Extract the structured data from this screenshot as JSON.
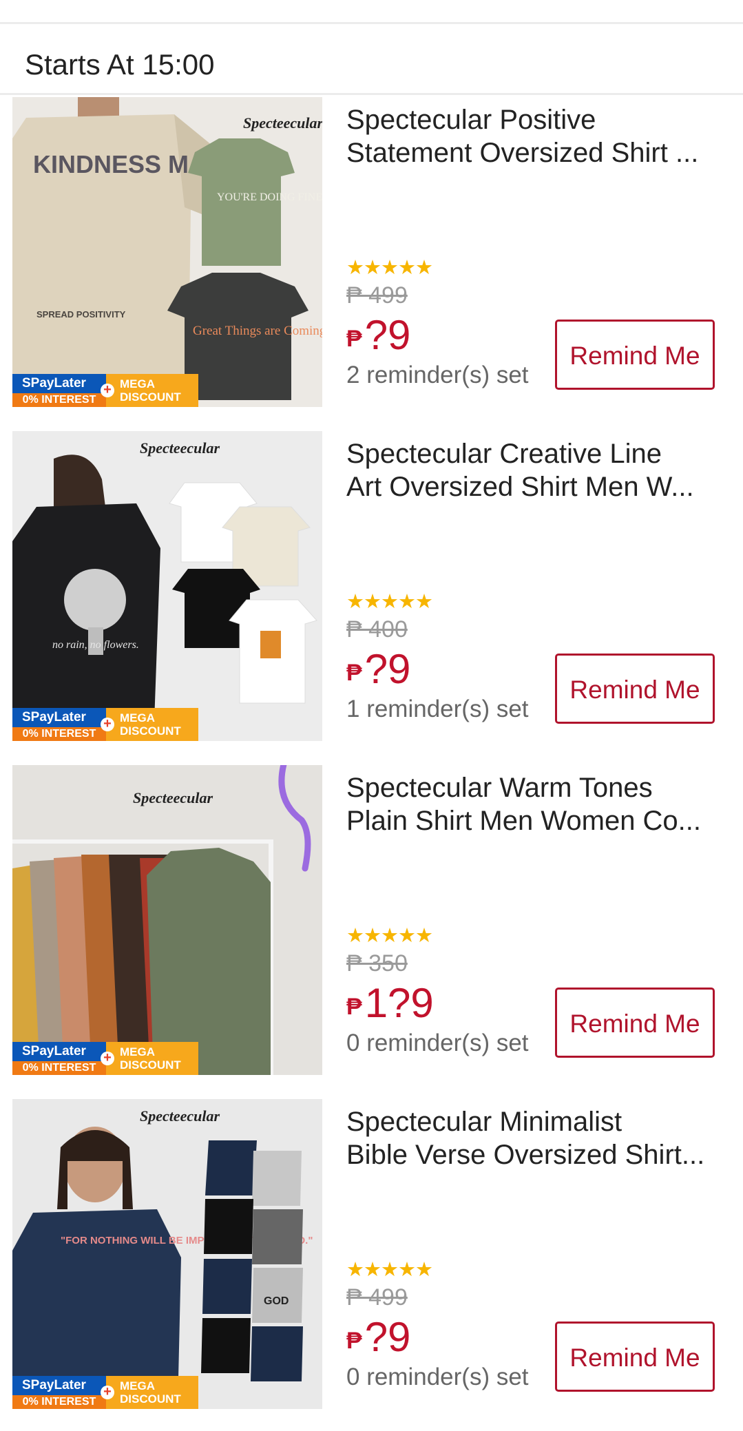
{
  "header": {
    "label": "Starts At 15:00"
  },
  "badges": {
    "spaylater": "SPayLater",
    "interest": "0% INTEREST",
    "mega_1": "MEGA",
    "mega_2": "DISCOUNT"
  },
  "colors": {
    "accent": "#c1122c",
    "star": "#f7b500",
    "strike": "#9a9a9a"
  },
  "products": [
    {
      "title_line1": "Spectecular Positive",
      "title_line2": "Statement Oversized Shirt ...",
      "rating_stars": "★★★★★",
      "original_price": "₱ 499",
      "currency": "₱",
      "flash_price": "?9",
      "reminders": "2 reminder(s) set",
      "button": "Remind Me",
      "image_text": {
        "brand": "Specteecular",
        "front": "KINDNESS MATTERS",
        "shirt2": "YOU'RE DOING FINE",
        "shirt3": "Great Things are Coming",
        "footer": "SPREAD POSITIVITY"
      }
    },
    {
      "title_line1": "Spectecular Creative Line",
      "title_line2": "Art Oversized Shirt Men W...",
      "rating_stars": "★★★★★",
      "original_price": "₱ 400",
      "currency": "₱",
      "flash_price": "?9",
      "reminders": "1 reminder(s) set",
      "button": "Remind Me",
      "image_text": {
        "brand": "Specteecular",
        "back": "no rain, no flowers."
      }
    },
    {
      "title_line1": "Spectecular Warm Tones",
      "title_line2": "Plain Shirt Men Women Co...",
      "rating_stars": "★★★★★",
      "original_price": "₱ 350",
      "currency": "₱",
      "flash_price": "1?9",
      "reminders": "0 reminder(s) set",
      "button": "Remind Me",
      "image_text": {
        "brand": "Specteecular"
      }
    },
    {
      "title_line1": "Spectecular Minimalist",
      "title_line2": "Bible Verse Oversized Shirt...",
      "rating_stars": "★★★★★",
      "original_price": "₱ 499",
      "currency": "₱",
      "flash_price": "?9",
      "reminders": "0 reminder(s) set",
      "button": "Remind Me",
      "image_text": {
        "brand": "Specteecular",
        "front": "\"FOR NOTHING WILL BE IMPOSSIBLE WITH GOD.\"",
        "shirt": "GOD"
      }
    }
  ]
}
